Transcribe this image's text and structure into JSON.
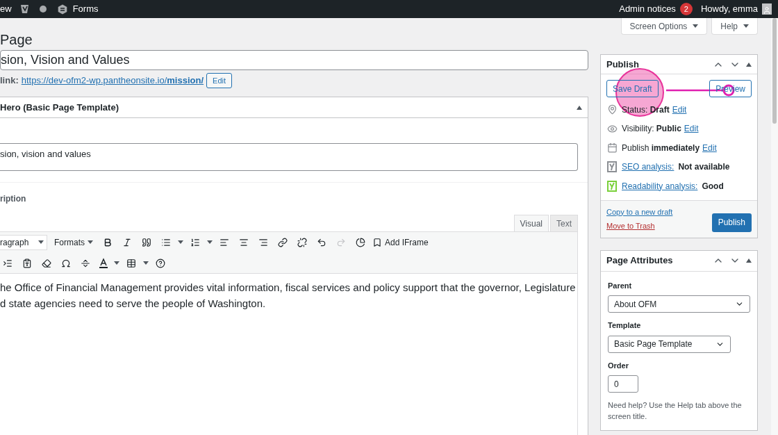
{
  "admin_bar": {
    "view_link": "ew",
    "forms_label": "Forms",
    "notices_label": "Admin notices",
    "notices_count": "2",
    "greeting": "Howdy, emma"
  },
  "screen_meta": [
    "Screen Options",
    "Help"
  ],
  "page_heading": "Page",
  "title_field": {
    "value": "sion, Vision and Values"
  },
  "permalink": {
    "label": "link:",
    "url": "https://dev-ofm2-wp.pantheonsite.io/**mission/**",
    "edit_button": "Edit"
  },
  "hero_box": {
    "title": "Hero (Basic Page Template)",
    "expanded": true,
    "headline_value": "sion, vision and values",
    "description_label": "ription",
    "editor_tabs": [
      {
        "label": "Visual",
        "selected": true
      },
      {
        "label": "Text",
        "selected": false
      }
    ],
    "toolbar": {
      "paragraph_select": "ragraph",
      "formats_menu": "Formats",
      "add_iframe": "Add IFrame",
      "redo_disabled": true
    },
    "content_lines": [
      "he Office of Financial Management provides vital information, fiscal services and policy support that the governor, Legislature",
      "d state agencies need to serve the people of Washington."
    ]
  },
  "publish_box": {
    "title": "Publish",
    "expanded": true,
    "save_draft": "Save Draft",
    "preview": "Preview",
    "rows": [
      {
        "kind": "status",
        "label": "Status:",
        "value": "Draft",
        "link": "Edit"
      },
      {
        "kind": "visibility",
        "label": "Visibility:",
        "value": "Public",
        "link": "Edit"
      },
      {
        "kind": "schedule",
        "label": "Publish",
        "value": "immediately",
        "link": "Edit"
      },
      {
        "kind": "analysis",
        "link": "SEO analysis:",
        "value": "Not available",
        "color": "#8c8f94"
      },
      {
        "kind": "analysis",
        "link": "Readability analysis:",
        "value": "Good",
        "color": "#7ad03a"
      }
    ],
    "copy_link": "Copy to a new draft",
    "trash_link": "Move to Trash",
    "publish_button": "Publish"
  },
  "attributes_box": {
    "title": "Page Attributes",
    "expanded": true,
    "parent_label": "Parent",
    "parent_value": "About OFM",
    "template_label": "Template",
    "template_value": "Basic Page Template",
    "order_label": "Order",
    "order_value": "0",
    "help": "Need help? Use the Help tab above the screen title."
  }
}
